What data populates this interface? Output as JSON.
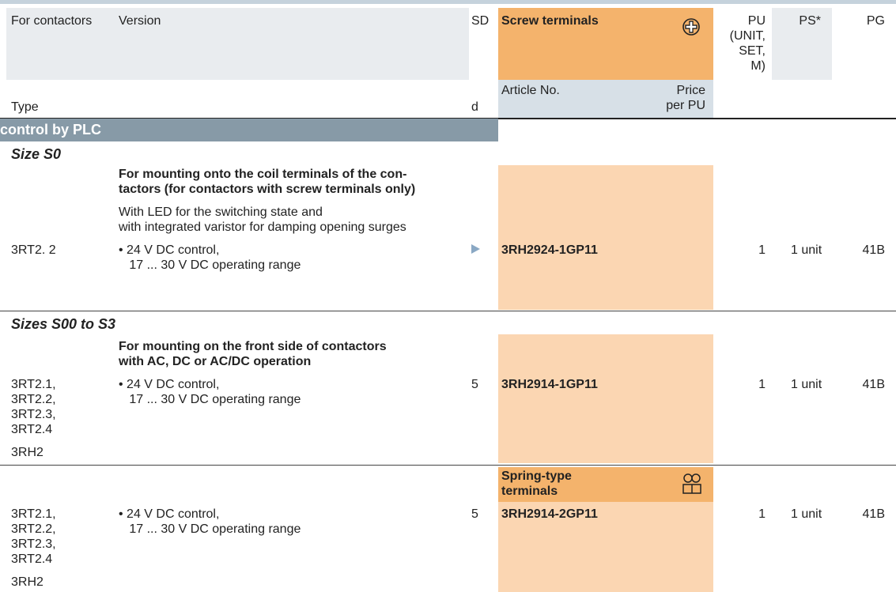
{
  "header": {
    "col_for_contactors": "For contactors",
    "col_version": "Version",
    "col_sd": "SD",
    "col_screw_terminals": "Screw terminals",
    "col_pu": "PU\n(UNIT,\nSET,\nM)",
    "col_ps": "PS*",
    "col_pg": "PG",
    "sub_type": "Type",
    "sub_d": "d",
    "sub_article_no": "Article No.",
    "sub_price": "Price\nper PU"
  },
  "section": {
    "title": "control by PLC"
  },
  "group1": {
    "title": "Size S0",
    "heading": "For mounting onto the coil terminals of the con-\ntactors (for contactors with screw terminals only)",
    "desc": "With LED for the switching state and\nwith integrated varistor for damping opening surges",
    "type": "3RT2. 2",
    "version": "• 24 V DC control,\n   17 ... 30 V DC operating range",
    "sd": "►",
    "article": "3RH2924-1GP11",
    "pu": "1",
    "ps": "1 unit",
    "pg": "41B"
  },
  "group2": {
    "title": "Sizes S00 to S3",
    "heading": "For mounting on the front side of contactors\nwith AC, DC or AC/DC operation",
    "type": "3RT2.1,\n3RT2.2,\n3RT2.3,\n3RT2.4",
    "type2": "3RH2",
    "version": "• 24 V DC control,\n   17 ... 30 V DC operating range",
    "sd": "5",
    "article": "3RH2914-1GP11",
    "pu": "1",
    "ps": "1 unit",
    "pg": "41B"
  },
  "group3": {
    "terminal_header": "Spring-type\nterminals",
    "type": "3RT2.1,\n3RT2.2,\n3RT2.3,\n3RT2.4",
    "type2": "3RH2",
    "version": "• 24 V DC control,\n   17 ... 30 V DC operating range",
    "sd": "5",
    "article": "3RH2914-2GP11",
    "pu": "1",
    "ps": "1 unit",
    "pg": "41B"
  },
  "colors": {
    "header_grey": "#e9ecef",
    "screw_orange": "#f4b36c",
    "light_orange": "#fbd6b2",
    "article_blue": "#d7e0e7",
    "section_bar": "#879aa7",
    "arrow": "#8aa8c4"
  },
  "icons": [
    "screw-terminal-icon",
    "spring-terminal-icon",
    "triangle-arrow-icon"
  ]
}
